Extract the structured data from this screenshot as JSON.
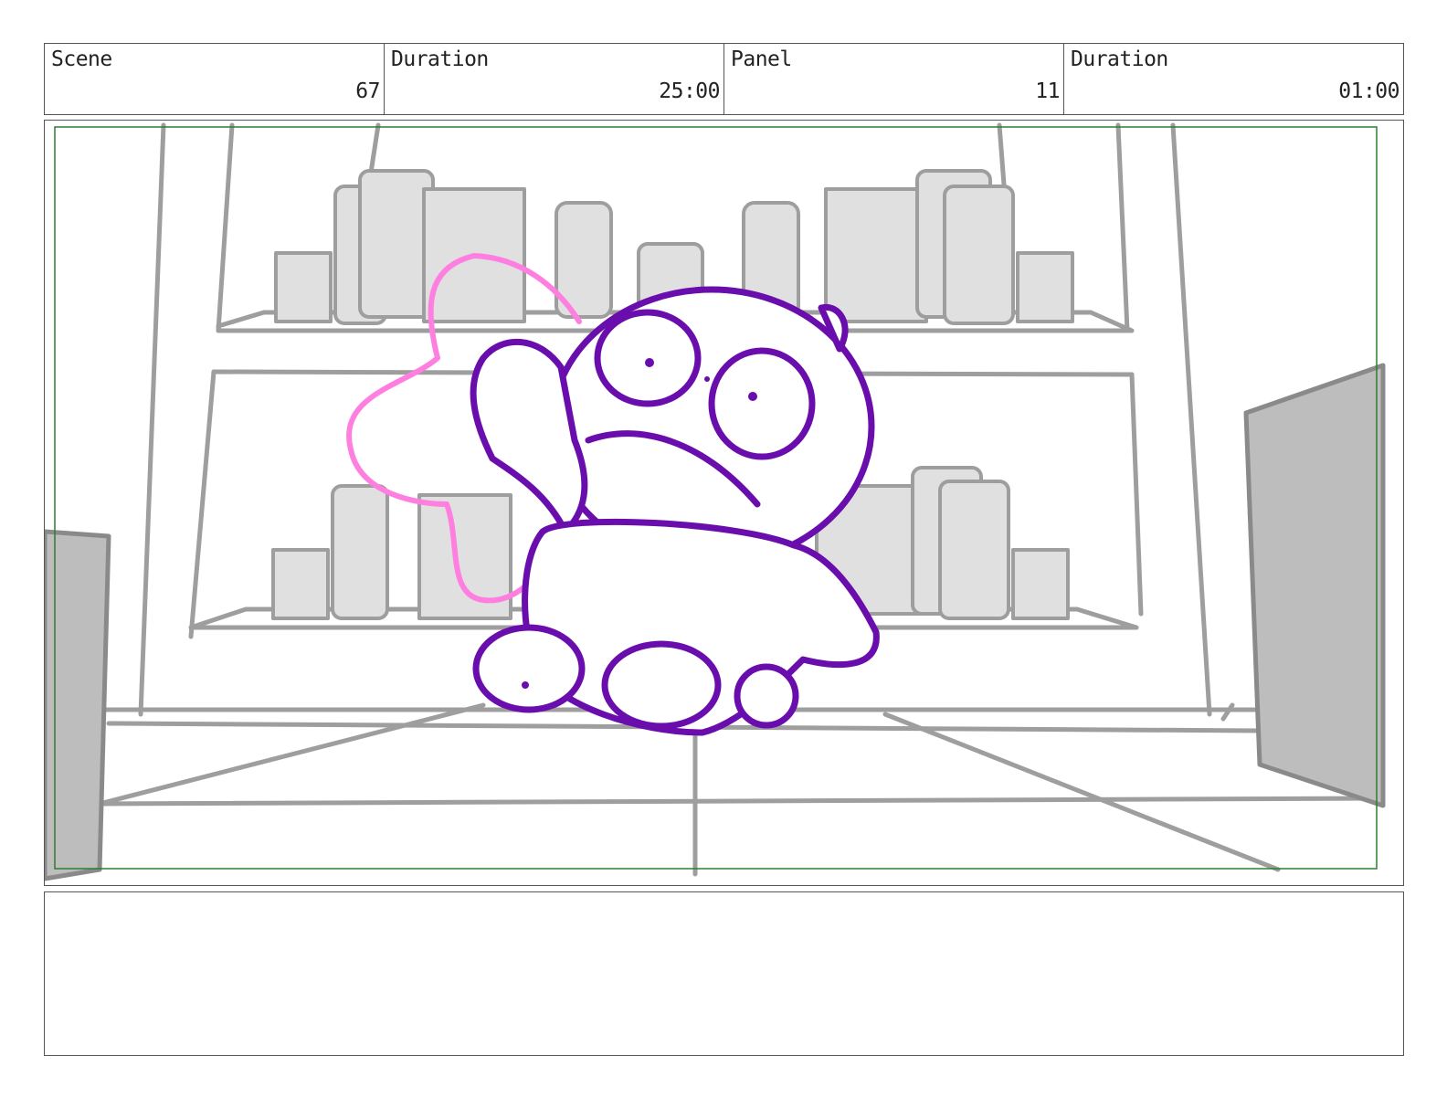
{
  "header": {
    "scene_label": "Scene",
    "scene_value": "67",
    "scene_duration_label": "Duration",
    "scene_duration_value": "25:00",
    "panel_label": "Panel",
    "panel_value": "11",
    "panel_duration_label": "Duration",
    "panel_duration_value": "01:00"
  },
  "notes": {
    "text": ""
  },
  "colors": {
    "frame_border": "#555555",
    "safe_area": "#2e7d32",
    "sketch_gray": "#9e9e9e",
    "fill_gray": "#e0e0e0",
    "character": "#6a0dad",
    "effect": "#ff7fe0"
  }
}
